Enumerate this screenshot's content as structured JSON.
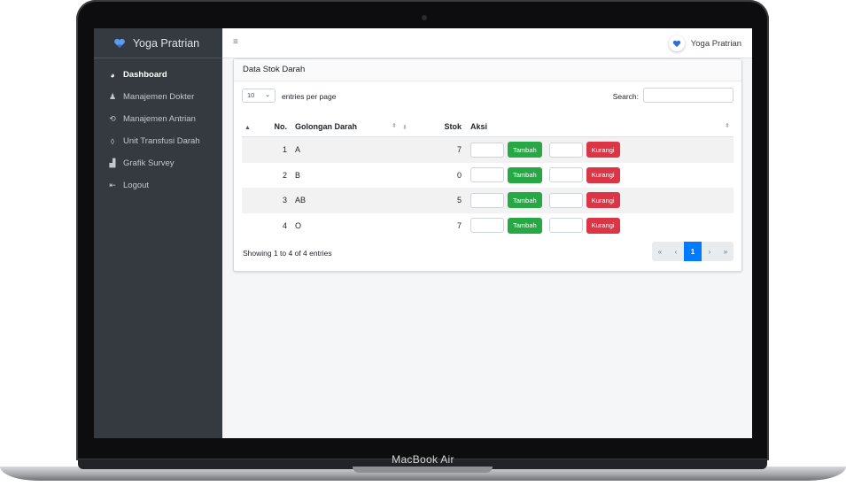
{
  "device": {
    "label": "MacBook Air"
  },
  "sidebar": {
    "brand": "Yoga Pratrian",
    "brand_icon": "heart-hand-icon",
    "items": [
      {
        "label": "Dashboard",
        "icon": "palette-icon",
        "active": true
      },
      {
        "label": "Manajemen Dokter",
        "icon": "user-doctor-icon",
        "active": false
      },
      {
        "label": "Manajemen Antrian",
        "icon": "repeat-icon",
        "active": false
      },
      {
        "label": "Unit Transfusi Darah",
        "icon": "droplet-icon",
        "active": false
      },
      {
        "label": "Grafik Survey",
        "icon": "bar-chart-icon",
        "active": false
      },
      {
        "label": "Logout",
        "icon": "logout-icon",
        "active": false
      }
    ]
  },
  "topbar": {
    "menu_icon": "hamburger-icon",
    "user_name": "Yoga Pratrian"
  },
  "card": {
    "title": "Data Stok Darah",
    "length_value": "10",
    "length_label": "entries per page",
    "search_label": "Search:",
    "columns": {
      "no": "No.",
      "golongan": "Golongan Darah",
      "stok": "Stok",
      "aksi": "Aksi"
    },
    "rows": [
      {
        "no": "1",
        "golongan": "A",
        "stok": "7"
      },
      {
        "no": "2",
        "golongan": "B",
        "stok": "0"
      },
      {
        "no": "3",
        "golongan": "AB",
        "stok": "5"
      },
      {
        "no": "4",
        "golongan": "O",
        "stok": "7"
      }
    ],
    "add_label": "Tambah",
    "reduce_label": "Kurangi",
    "info": "Showing 1 to 4 of 4 entries",
    "pagination": {
      "first": "«",
      "prev": "‹",
      "current": "1",
      "next": "›",
      "last": "»"
    }
  },
  "colors": {
    "sidebar_bg": "#343a40",
    "primary": "#007bff",
    "success": "#28a745",
    "danger": "#dc3545"
  }
}
